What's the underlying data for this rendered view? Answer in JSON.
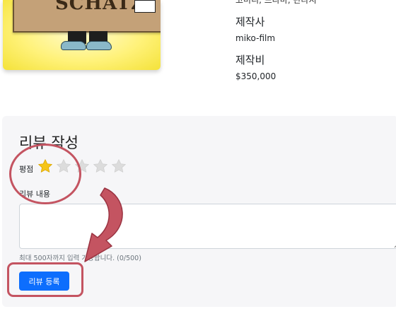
{
  "movie": {
    "poster_text": "SCHATZ!",
    "genre_text": "코미디, 드라마, 판타지",
    "producer_label": "제작사",
    "producer_value": "miko-film",
    "budget_label": "제작비",
    "budget_value": "$350,000"
  },
  "review_form": {
    "title": "리뷰 작성",
    "rating_label": "평점",
    "rating": 1,
    "rating_max": 5,
    "content_label": "리뷰 내용",
    "content_value": "",
    "help_text": "최대 500자까지 입력 가능합니다. (0/500)",
    "submit_label": "리뷰 등록"
  },
  "colors": {
    "accent": "#0d6efd",
    "star_filled": "#f5c518",
    "star_empty": "#dcdcdc",
    "annotation": "#c45461"
  }
}
